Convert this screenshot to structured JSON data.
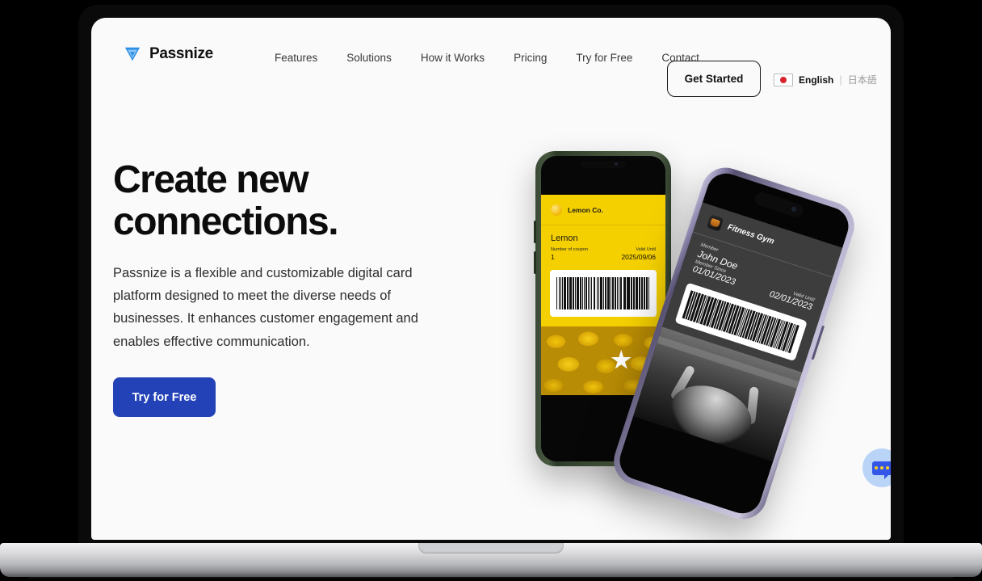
{
  "brand": {
    "name": "Passnize",
    "logo_icon": "passnize-triangle-logo",
    "accent": "#2342b8"
  },
  "nav": {
    "links": [
      {
        "label": "Features"
      },
      {
        "label": "Solutions"
      },
      {
        "label": "How it Works"
      },
      {
        "label": "Pricing"
      },
      {
        "label": "Try for Free"
      },
      {
        "label": "Contact"
      }
    ],
    "get_started": "Get Started",
    "language": {
      "flag_icon": "japan-flag-icon",
      "active": "English",
      "separator": "|",
      "alternate": "日本語"
    }
  },
  "hero": {
    "heading": "Create new\nconnections.",
    "paragraph": "Passnize is a flexible and customizable digital card platform designed to meet the diverse needs of businesses. It enhances customer engagement and enables effective communication.",
    "cta": "Try for Free"
  },
  "phones": {
    "coupon_card": {
      "brand": "Lemon Co.",
      "logo_icon": "lemon-icon",
      "title": "Lemon",
      "count_label": "Number of coupon",
      "count_value": "1",
      "valid_label": "Valid Until",
      "valid_value": "2025/09/06",
      "barcode_icon": "barcode-icon",
      "photo_icon": "lemons-photo",
      "star_icon": "star-icon",
      "card_color": "#f5d000",
      "frame_color": "#435239"
    },
    "membership_card": {
      "brand": "Fitness Gym",
      "logo_icon": "dumbbell-icon",
      "member_label": "Member",
      "member_value": "John Doe",
      "since_label": "Member Since",
      "since_value": "01/01/2023",
      "valid_label": "Valid Until",
      "valid_value": "02/01/2023",
      "barcode_icon": "barcode-icon",
      "photo_icon": "gym-bench-press-photo",
      "card_color": "#3d3d3d",
      "frame_color": "#a9a3c4"
    }
  },
  "chat_widget": {
    "icon": "chat-bubble-icon",
    "color": "#3355e8",
    "background": "#b9d4f7"
  }
}
